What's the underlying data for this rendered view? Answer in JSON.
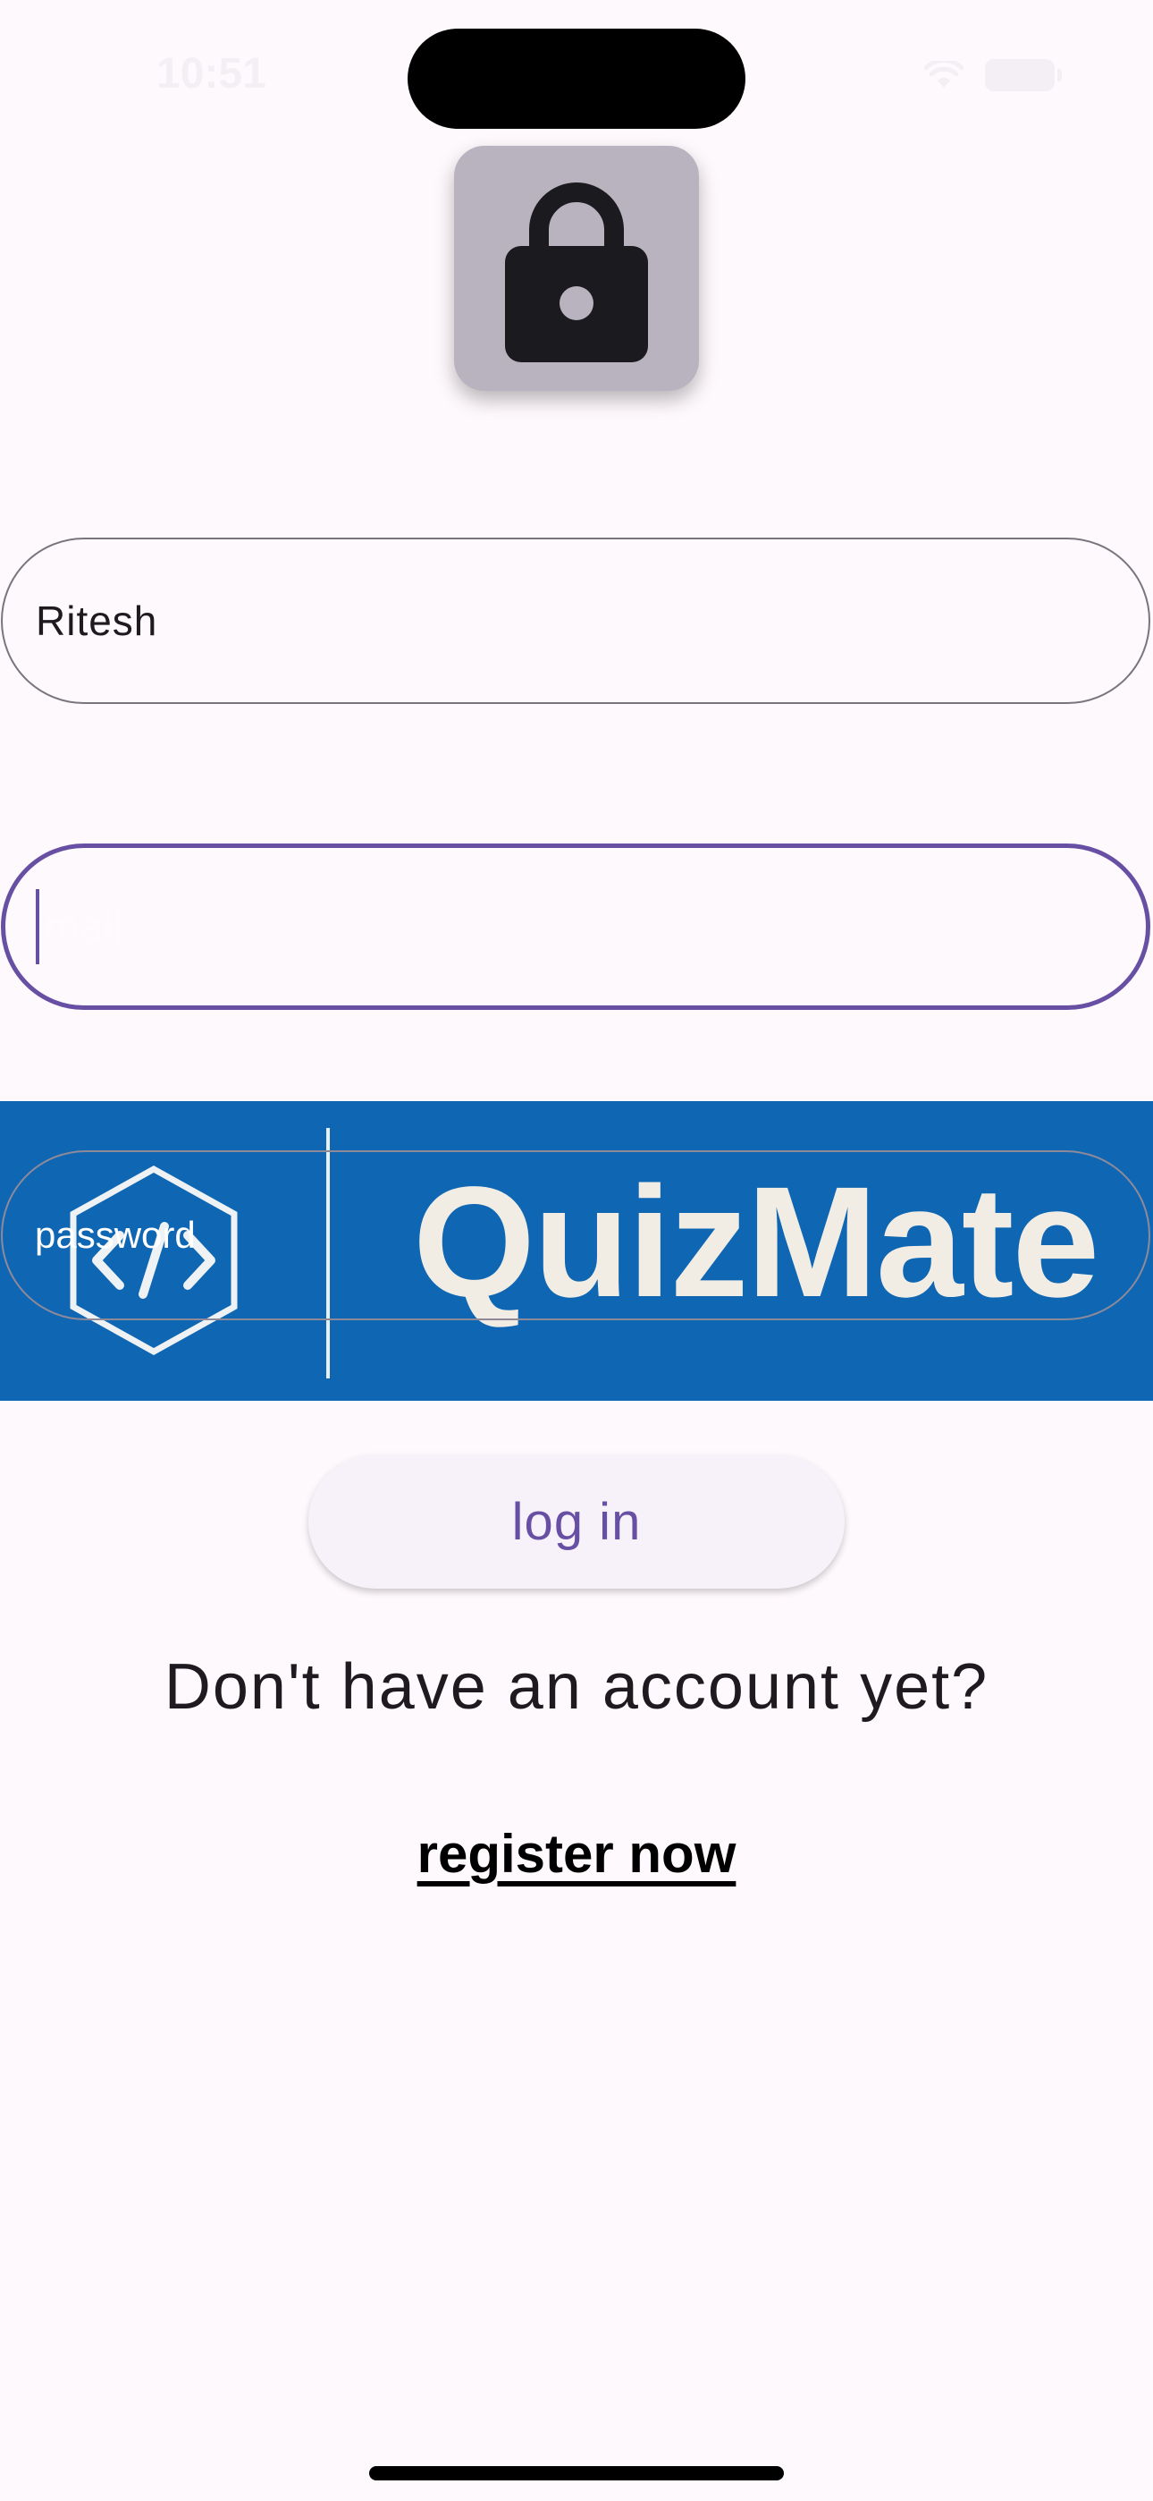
{
  "status_bar": {
    "time": "10:51"
  },
  "lock": {
    "icon": "lock-icon"
  },
  "form": {
    "username_value": "Ritesh",
    "email_value": "mail",
    "password_placeholder": "password"
  },
  "banner": {
    "logo_glyph": "</>",
    "title": "QuizMate"
  },
  "actions": {
    "login_label": "log in",
    "prompt": "Don't have an account yet?",
    "register_label": "register now"
  },
  "colors": {
    "accent": "#6750a4",
    "banner": "#0f66b2",
    "background": "#fef9fd"
  }
}
